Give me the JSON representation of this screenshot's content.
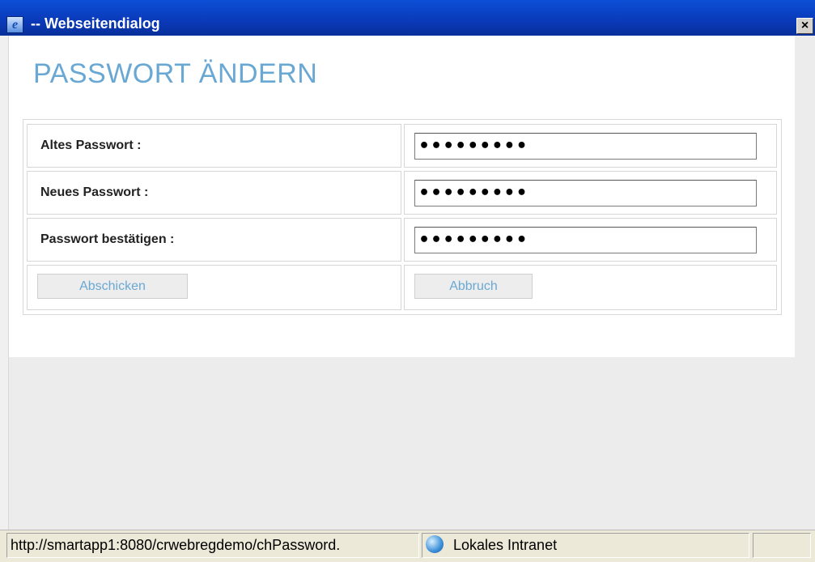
{
  "window": {
    "title": "-- Webseitendialog",
    "close_label": "×",
    "app_icon": "ie-icon"
  },
  "page": {
    "heading": "PASSWORT ÄNDERN"
  },
  "form": {
    "fields": [
      {
        "label": "Altes Passwort :",
        "value": "•••••••••"
      },
      {
        "label": "Neues Passwort :",
        "value": "•••••••••"
      },
      {
        "label": "Passwort bestätigen :",
        "value": "•••••••••"
      }
    ],
    "submit_label": "Abschicken",
    "cancel_label": "Abbruch"
  },
  "statusbar": {
    "url": "http://smartapp1:8080/crwebregdemo/chPassword.",
    "zone_label": "Lokales Intranet",
    "zone_icon": "globe-icon"
  },
  "colors": {
    "accent": "#6aa8d4",
    "titlebar": "#0a39b8"
  }
}
